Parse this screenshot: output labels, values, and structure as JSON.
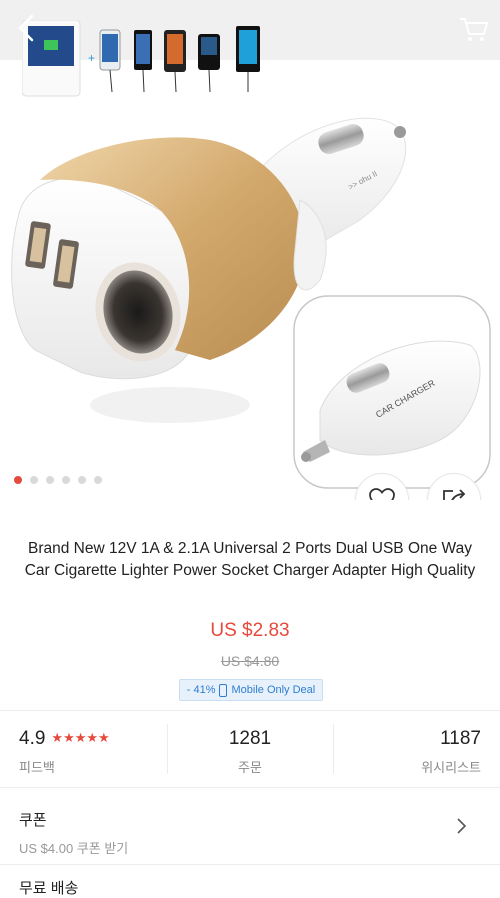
{
  "product": {
    "title": "Brand New 12V 1A & 2.1A Universal 2 Ports Dual USB One Way Car Cigarette Lighter Power Socket Charger Adapter High Quality",
    "price": "US $2.83",
    "original_price": "US $4.80",
    "deal_discount": "- 41%",
    "deal_label": "Mobile Only Deal",
    "image_label": "CAR CHARGER"
  },
  "gallery": {
    "image_count": 6,
    "active_index": 0
  },
  "stats": {
    "rating": {
      "value": "4.9",
      "stars": "★★★★★",
      "label": "피드백"
    },
    "orders": {
      "value": "1281",
      "label": "주문"
    },
    "wishlist": {
      "value": "1187",
      "label": "위시리스트"
    }
  },
  "coupon": {
    "title": "쿠폰",
    "subtitle": "US $4.00 쿠폰 받기"
  },
  "shipping": {
    "title": "무료 배송"
  },
  "colors": {
    "accent": "#e64a3c",
    "gold": "#d8b27a",
    "deal_blue": "#2f7dd1"
  },
  "icons": [
    "back-arrow-icon",
    "cart-icon",
    "heart-icon",
    "share-icon",
    "chevron-right-icon"
  ]
}
